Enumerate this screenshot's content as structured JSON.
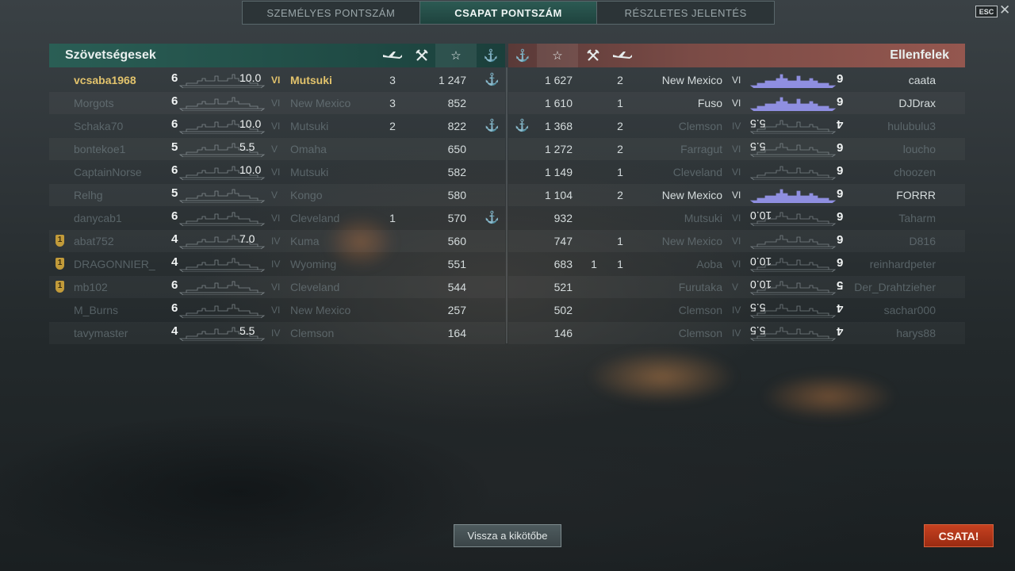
{
  "tabs": [
    {
      "label": "SZEMÉLYES PONTSZÁM",
      "active": false
    },
    {
      "label": "CSAPAT PONTSZÁM",
      "active": true
    },
    {
      "label": "RÉSZLETES JELENTÉS",
      "active": false
    }
  ],
  "esc_label": "ESC",
  "allies": {
    "title": "Szövetségesek",
    "header_icons": [
      "plane-icon",
      "crossed-swords-icon",
      "star-icon",
      "anchor-icon"
    ],
    "rows": [
      {
        "name": "vcsaba1968",
        "tier": "6",
        "speed": "10.0",
        "tier_roman": "VI",
        "ship": "Mutsuki",
        "kills": "3",
        "score": "1 247",
        "anchor": true,
        "badge": "",
        "style": "self"
      },
      {
        "name": "Morgots",
        "tier": "6",
        "speed": "",
        "tier_roman": "VI",
        "ship": "New Mexico",
        "kills": "3",
        "score": "852",
        "anchor": false,
        "badge": "",
        "style": "dead"
      },
      {
        "name": "Schaka70",
        "tier": "6",
        "speed": "10.0",
        "tier_roman": "VI",
        "ship": "Mutsuki",
        "kills": "2",
        "score": "822",
        "anchor": true,
        "badge": "",
        "style": "dead"
      },
      {
        "name": "bontekoe1",
        "tier": "5",
        "speed": "5.5",
        "tier_roman": "V",
        "ship": "Omaha",
        "kills": "",
        "score": "650",
        "anchor": false,
        "badge": "",
        "style": "dead"
      },
      {
        "name": "CaptainNorse",
        "tier": "6",
        "speed": "10.0",
        "tier_roman": "VI",
        "ship": "Mutsuki",
        "kills": "",
        "score": "582",
        "anchor": false,
        "badge": "",
        "style": "dead"
      },
      {
        "name": "Relhg",
        "tier": "5",
        "speed": "",
        "tier_roman": "V",
        "ship": "Kongo",
        "kills": "",
        "score": "580",
        "anchor": false,
        "badge": "",
        "style": "dead"
      },
      {
        "name": "danycab1",
        "tier": "6",
        "speed": "",
        "tier_roman": "VI",
        "ship": "Cleveland",
        "kills": "1",
        "score": "570",
        "anchor": true,
        "badge": "",
        "style": "dead"
      },
      {
        "name": "abat752",
        "tier": "4",
        "speed": "7.0",
        "tier_roman": "IV",
        "ship": "Kuma",
        "kills": "",
        "score": "560",
        "anchor": false,
        "badge": "1",
        "style": "dead"
      },
      {
        "name": "DRAGONNIER_",
        "tier": "4",
        "speed": "",
        "tier_roman": "IV",
        "ship": "Wyoming",
        "kills": "",
        "score": "551",
        "anchor": false,
        "badge": "1",
        "style": "dead"
      },
      {
        "name": "mb102",
        "tier": "6",
        "speed": "",
        "tier_roman": "VI",
        "ship": "Cleveland",
        "kills": "",
        "score": "544",
        "anchor": false,
        "badge": "1",
        "style": "dead"
      },
      {
        "name": "M_Burns",
        "tier": "6",
        "speed": "",
        "tier_roman": "VI",
        "ship": "New Mexico",
        "kills": "",
        "score": "257",
        "anchor": false,
        "badge": "",
        "style": "dead"
      },
      {
        "name": "tavymaster",
        "tier": "4",
        "speed": "5.5",
        "tier_roman": "IV",
        "ship": "Clemson",
        "kills": "",
        "score": "164",
        "anchor": false,
        "badge": "",
        "style": "dead"
      }
    ]
  },
  "enemies": {
    "title": "Ellenfelek",
    "header_icons": [
      "anchor-icon",
      "star-icon",
      "crossed-swords-icon",
      "plane-icon"
    ],
    "rows": [
      {
        "name": "caata",
        "score": "1 627",
        "planes": "",
        "kills": "2",
        "ship": "New Mexico",
        "tier_roman": "VI",
        "tier": "6",
        "speed": "",
        "anchor": false,
        "alive": true
      },
      {
        "name": "DJDrax",
        "score": "1 610",
        "planes": "",
        "kills": "1",
        "ship": "Fuso",
        "tier_roman": "VI",
        "tier": "6",
        "speed": "",
        "anchor": false,
        "alive": true
      },
      {
        "name": "hulubulu3",
        "score": "1 368",
        "planes": "",
        "kills": "2",
        "ship": "Clemson",
        "tier_roman": "IV",
        "tier": "4",
        "speed": "5.5",
        "anchor": true,
        "alive": false
      },
      {
        "name": "loucho",
        "score": "1 272",
        "planes": "",
        "kills": "2",
        "ship": "Farragut",
        "tier_roman": "VI",
        "tier": "6",
        "speed": "5.5",
        "anchor": false,
        "alive": false
      },
      {
        "name": "choozen",
        "score": "1 149",
        "planes": "",
        "kills": "1",
        "ship": "Cleveland",
        "tier_roman": "VI",
        "tier": "6",
        "speed": "",
        "anchor": false,
        "alive": false
      },
      {
        "name": "FORRR",
        "score": "1 104",
        "planes": "",
        "kills": "2",
        "ship": "New Mexico",
        "tier_roman": "VI",
        "tier": "6",
        "speed": "",
        "anchor": false,
        "alive": true
      },
      {
        "name": "Taharm",
        "score": "932",
        "planes": "",
        "kills": "",
        "ship": "Mutsuki",
        "tier_roman": "VI",
        "tier": "6",
        "speed": "10.0",
        "anchor": false,
        "alive": false
      },
      {
        "name": "D816",
        "score": "747",
        "planes": "",
        "kills": "1",
        "ship": "New Mexico",
        "tier_roman": "VI",
        "tier": "6",
        "speed": "",
        "anchor": false,
        "alive": false
      },
      {
        "name": "reinhardpeter",
        "score": "683",
        "planes": "1",
        "kills": "1",
        "ship": "Aoba",
        "tier_roman": "VI",
        "tier": "6",
        "speed": "10.0",
        "anchor": false,
        "alive": false
      },
      {
        "name": "Der_Drahtzieher",
        "score": "521",
        "planes": "",
        "kills": "",
        "ship": "Furutaka",
        "tier_roman": "V",
        "tier": "5",
        "speed": "10.0",
        "anchor": false,
        "alive": false
      },
      {
        "name": "sachar000",
        "score": "502",
        "planes": "",
        "kills": "",
        "ship": "Clemson",
        "tier_roman": "IV",
        "tier": "4",
        "speed": "5.5",
        "anchor": false,
        "alive": false
      },
      {
        "name": "harys88",
        "score": "146",
        "planes": "",
        "kills": "",
        "ship": "Clemson",
        "tier_roman": "IV",
        "tier": "4",
        "speed": "5.5",
        "anchor": false,
        "alive": false
      }
    ]
  },
  "footer": {
    "back_label": "Vissza a kikötőbe",
    "battle_label": "CSATA!"
  },
  "colors": {
    "ally_header": "#2a5e55",
    "enemy_header": "#94574f",
    "self_name": "#e2c36c",
    "alive_enemy_silhouette": "#8f8fe0",
    "battle_button": "#c64120"
  }
}
